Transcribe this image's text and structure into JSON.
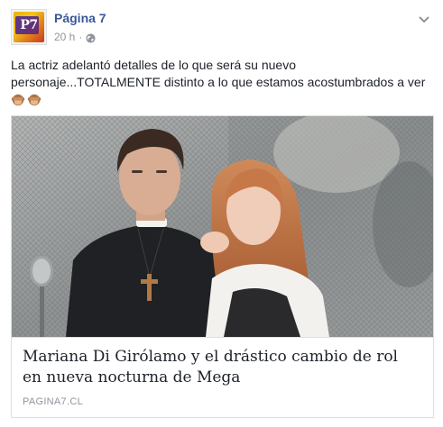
{
  "post": {
    "page_name": "Página 7",
    "time": "20 h",
    "separator": "·",
    "avatar_text": "P7",
    "text": "La actriz adelantó detalles de lo que será su nuevo personaje...TOTALMENTE distinto a lo que estamos acostumbrados a ver",
    "emojis": [
      "see-no-evil-monkey-icon",
      "see-no-evil-monkey-icon"
    ]
  },
  "link_card": {
    "title": "Mariana Di Girólamo y el drástico cambio de rol en nueva nocturna de Mega",
    "domain": "PAGINA7.CL"
  },
  "colors": {
    "link": "#365899",
    "text": "#1d2129",
    "meta": "#90949c",
    "border": "#dddfe2"
  }
}
